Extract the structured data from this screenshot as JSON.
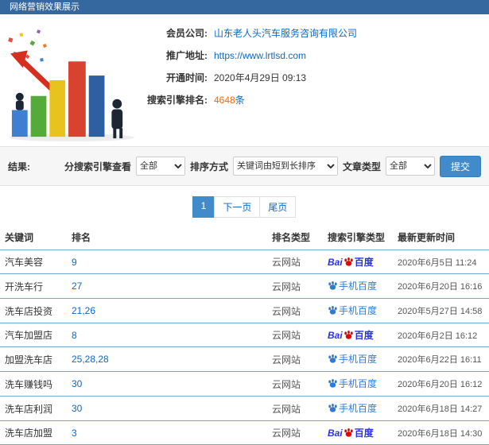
{
  "header": {
    "title": "网络营销效果展示"
  },
  "info": {
    "company_label": "会员公司:",
    "company_value": "山东老人头汽车服务咨询有限公司",
    "url_label": "推广地址:",
    "url_value": "https://www.lrtlsd.com",
    "open_label": "开通时间:",
    "open_value": "2020年4月29日 09:13",
    "rank_label": "搜索引擎排名:",
    "rank_value": "4648",
    "rank_unit": "条"
  },
  "filters": {
    "section_label": "结果:",
    "engine_label": "分搜索引擎查看",
    "engine_value": "全部",
    "sort_label": "排序方式",
    "sort_value": "关键词由短到长排序",
    "article_label": "文章类型",
    "article_value": "全部",
    "submit_label": "提交"
  },
  "pagination": {
    "current": "1",
    "next": "下一页",
    "last": "尾页"
  },
  "table": {
    "headers": [
      "关键词",
      "排名",
      "排名类型",
      "搜索引擎类型",
      "最新更新时间"
    ],
    "engines": {
      "baidu": {
        "prefix": "Bai",
        "suffix": "百度"
      },
      "mobile-baidu": {
        "label": "手机百度"
      }
    },
    "rows": [
      {
        "keyword": "汽车美容",
        "rank": "9",
        "rank_type": "云网站",
        "engine": "baidu",
        "time": "2020年6月5日 11:24"
      },
      {
        "keyword": "开洗车行",
        "rank": "27",
        "rank_type": "云网站",
        "engine": "mobile-baidu",
        "time": "2020年6月20日 16:16"
      },
      {
        "keyword": "洗车店投资",
        "rank": "21,26",
        "rank_type": "云网站",
        "engine": "mobile-baidu",
        "time": "2020年5月27日 14:58"
      },
      {
        "keyword": "汽车加盟店",
        "rank": "8",
        "rank_type": "云网站",
        "engine": "baidu",
        "time": "2020年6月2日 16:12"
      },
      {
        "keyword": "加盟洗车店",
        "rank": "25,28,28",
        "rank_type": "云网站",
        "engine": "mobile-baidu",
        "time": "2020年6月22日 16:11"
      },
      {
        "keyword": "洗车赚钱吗",
        "rank": "30",
        "rank_type": "云网站",
        "engine": "mobile-baidu",
        "time": "2020年6月20日 16:12"
      },
      {
        "keyword": "洗车店利润",
        "rank": "30",
        "rank_type": "云网站",
        "engine": "mobile-baidu",
        "time": "2020年6月18日 14:27"
      },
      {
        "keyword": "洗车店加盟",
        "rank": "3",
        "rank_type": "云网站",
        "engine": "baidu",
        "time": "2020年6月18日 14:30"
      }
    ]
  },
  "colors": {
    "topbar": "#35689e",
    "link": "#0a68c8",
    "highlight": "#ff6600",
    "primary": "#428bca",
    "table-line": "#6fa7da",
    "baidu-blue": "#2932e1",
    "baidu-red": "#e10601",
    "mobile-blue": "#2d7bd9",
    "filter-bg": "#f6f6f6",
    "border": "#e2e2e2"
  }
}
